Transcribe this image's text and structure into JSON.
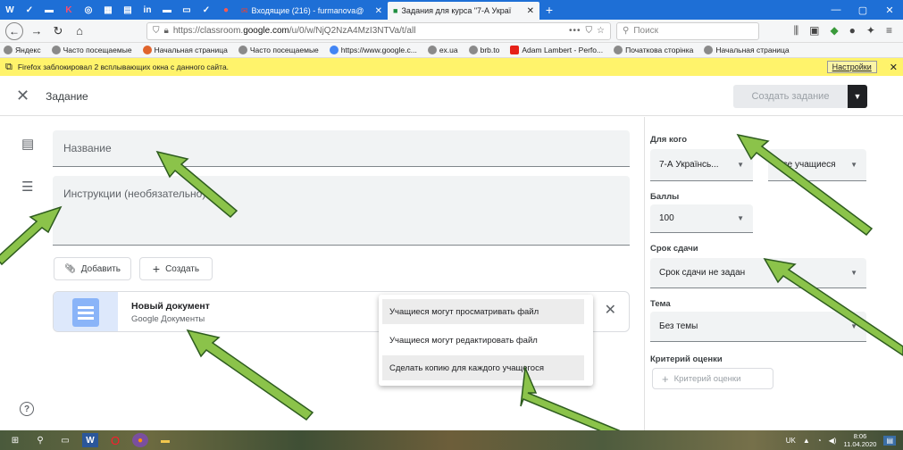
{
  "browser": {
    "tabs": [
      {
        "label": "Входящие (216) - furmanova@"
      },
      {
        "label": "Задания для курса \"7-А Украї"
      }
    ],
    "url_prefix": "https://classroom.",
    "url_domain": "google.com",
    "url_path": "/u/0/w/NjQ2NzA4MzI3NTVa/t/all",
    "search_placeholder": "Поиск",
    "bookmarks": [
      "Яндекс",
      "Часто посещаемые",
      "Начальная страница",
      "Часто посещаемые",
      "https://www.google.c...",
      "ex.ua",
      "brb.to",
      "Adam Lambert - Perfo...",
      "Початкова сторінка",
      "Начальная страница"
    ],
    "notification": {
      "text": "Firefox заблокировал 2 всплывающих окна с данного сайта.",
      "settings_label": "Настройки"
    }
  },
  "header": {
    "title": "Задание",
    "create_label": "Создать задание"
  },
  "form": {
    "title_placeholder": "Название",
    "instructions_placeholder": "Инструкции (необязательно)",
    "add_label": "Добавить",
    "create_label": "Создать"
  },
  "attachment": {
    "name": "Новый документ",
    "type": "Google Документы",
    "menu": [
      "Учащиеся могут просматривать файл",
      "Учащиеся могут редактировать файл",
      "Сделать копию для каждого учащегося"
    ]
  },
  "sidebar": {
    "for_label": "Для кого",
    "class_value": "7-А Українсь...",
    "students_value": "Все учащиеся",
    "points_label": "Баллы",
    "points_value": "100",
    "due_label": "Срок сдачи",
    "due_value": "Срок сдачи не задан",
    "topic_label": "Тема",
    "topic_value": "Без темы",
    "rubric_label": "Критерий оценки",
    "rubric_button": "Критерий оценки"
  },
  "taskbar": {
    "lang": "UK",
    "time": "8:06",
    "date": "11.04.2020"
  },
  "colors": {
    "tab_bar": "#1e6fd6",
    "notification": "#fff36b",
    "arrow_fill": "#8bc34a",
    "arrow_stroke": "#2e5c1f"
  }
}
